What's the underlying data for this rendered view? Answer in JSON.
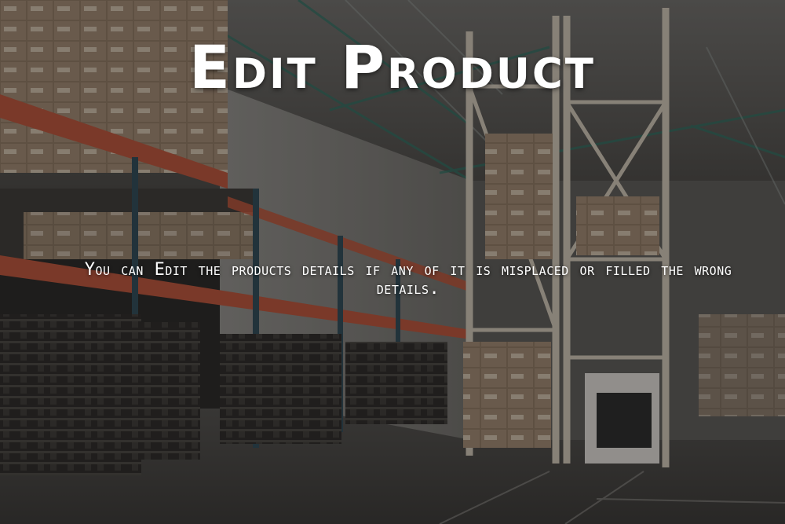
{
  "hero": {
    "title": "Edit Product",
    "subtitle": "You can Edit the products details if any of it is misplaced or filled the wrong details."
  },
  "colors": {
    "text": "#ffffff",
    "shelf_accent": "#b5533a",
    "rack_frame": "#c9bfb0",
    "cardboard": "#a58d74"
  },
  "icons": {
    "background": "warehouse-photo"
  }
}
